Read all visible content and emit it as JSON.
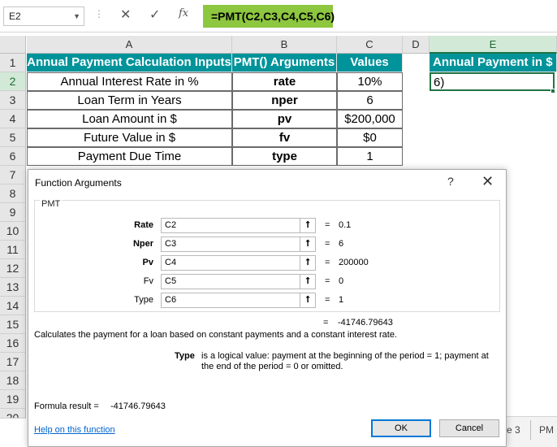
{
  "formula_bar": {
    "name_box": "E2",
    "formula": "=PMT(C2,C3,C4,C5,C6)",
    "fx_label": "fx"
  },
  "columns": [
    "A",
    "B",
    "C",
    "D",
    "E"
  ],
  "rows": [
    "1",
    "2",
    "3",
    "4",
    "5",
    "6",
    "7",
    "8",
    "9",
    "10",
    "11",
    "12",
    "13",
    "14",
    "15",
    "16",
    "17",
    "18",
    "19",
    "20"
  ],
  "sheet": {
    "header": {
      "a": "Annual Payment Calculation Inputs",
      "b": "PMT() Arguments",
      "c": "Values",
      "e": "Annual Payment in $"
    },
    "data": [
      {
        "a": "Annual Interest Rate in %",
        "b": "rate",
        "c": "10%"
      },
      {
        "a": "Loan Term in Years",
        "b": "nper",
        "c": "6"
      },
      {
        "a": "Loan Amount in $",
        "b": "pv",
        "c": "$200,000"
      },
      {
        "a": "Future Value in $",
        "b": "fv",
        "c": "$0"
      },
      {
        "a": "Payment Due Time",
        "b": "type",
        "c": "1"
      }
    ],
    "e2": "6)"
  },
  "dialog": {
    "title": "Function Arguments",
    "help_glyph": "?",
    "close_glyph": "✕",
    "function_name": "PMT",
    "args": [
      {
        "label": "Rate",
        "input": "C2",
        "value": "0.1"
      },
      {
        "label": "Nper",
        "input": "C3",
        "value": "6"
      },
      {
        "label": "Pv",
        "input": "C4",
        "value": "200000"
      },
      {
        "label": "Fv",
        "input": "C5",
        "value": "0"
      },
      {
        "label": "Type",
        "input": "C6",
        "value": "1"
      }
    ],
    "equals": "=",
    "total_value": "-41746.79643",
    "description": "Calculates the payment for a loan based on constant payments and a constant interest rate.",
    "arg_name": "Type",
    "arg_description": "is a logical value: payment at the beginning of the period = 1; payment at the end of the period = 0 or omitted.",
    "result_label": "Formula result =",
    "result_value": "-41746.79643",
    "help_link": "Help on this function",
    "ok_label": "OK",
    "cancel_label": "Cancel"
  },
  "sheet_tabs": [
    "e 3",
    "PM"
  ]
}
